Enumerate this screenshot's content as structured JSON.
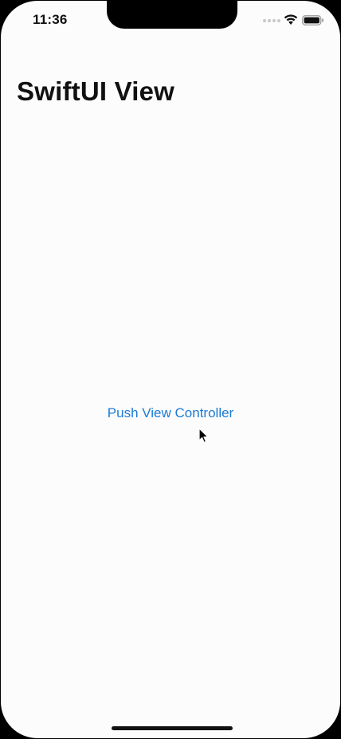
{
  "status_bar": {
    "time": "11:36",
    "icons": [
      "cellular-signal-icon",
      "wifi-icon",
      "battery-icon"
    ]
  },
  "navigation": {
    "title": "SwiftUI View"
  },
  "content": {
    "push_button_label": "Push View Controller"
  },
  "colors": {
    "background": "#fcfcfc",
    "accent": "#1b7bd6",
    "title_text": "#111111"
  }
}
